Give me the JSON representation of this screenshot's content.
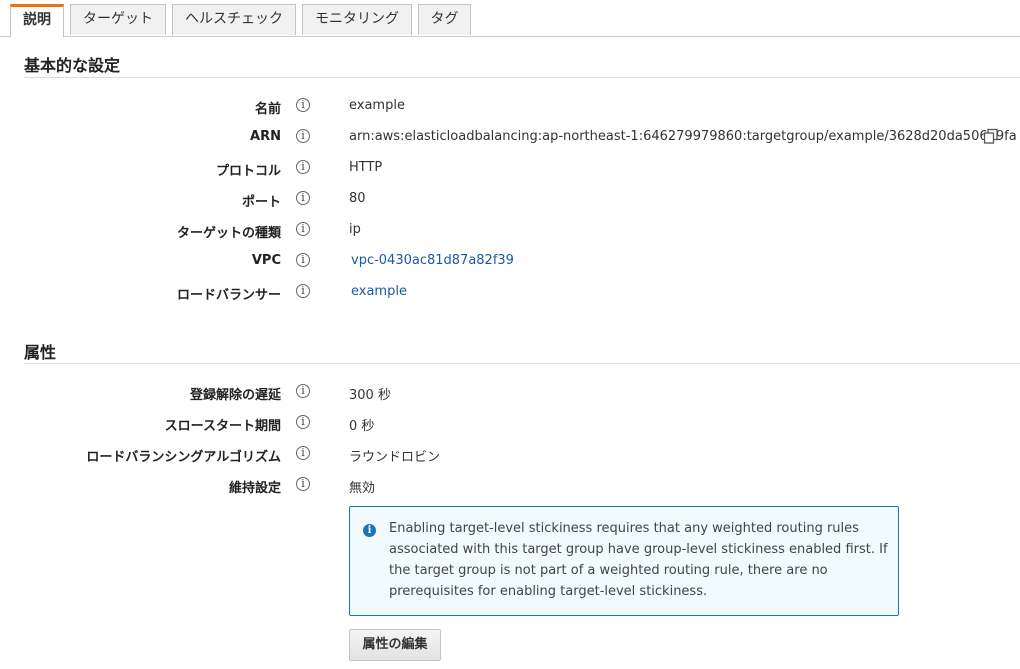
{
  "tabs": [
    {
      "label": "説明",
      "active": true
    },
    {
      "label": "ターゲット",
      "active": false
    },
    {
      "label": "ヘルスチェック",
      "active": false
    },
    {
      "label": "モニタリング",
      "active": false
    },
    {
      "label": "タグ",
      "active": false
    }
  ],
  "basic": {
    "title": "基本的な設定",
    "rows": [
      {
        "label": "名前",
        "value": "example"
      },
      {
        "label": "ARN",
        "value": "arn:aws:elasticloadbalancing:ap-northeast-1:646279979860:targetgroup/example/3628d20da50689fa"
      },
      {
        "label": "プロトコル",
        "value": "HTTP"
      },
      {
        "label": "ポート",
        "value": "80"
      },
      {
        "label": "ターゲットの種類",
        "value": "ip"
      },
      {
        "label": "VPC",
        "value": "vpc-0430ac81d87a82f39"
      },
      {
        "label": "ロードバランサー",
        "value": "example"
      }
    ]
  },
  "attributes": {
    "title": "属性",
    "rows": [
      {
        "label": "登録解除の遅延",
        "value": "300 秒"
      },
      {
        "label": "スロースタート期間",
        "value": "0 秒"
      },
      {
        "label": "ロードバランシングアルゴリズム",
        "value": "ラウンドロビン"
      },
      {
        "label": "維持設定",
        "value": "無効"
      }
    ]
  },
  "alert": {
    "text": "Enabling target-level stickiness requires that any weighted routing rules associated with this target group have group-level stickiness enabled first. If the target group is not part of a weighted routing rule, there are no prerequisites for enabling target-level stickiness."
  },
  "edit_button_label": "属性の編集",
  "icons": {
    "info": "info-icon",
    "copy": "copy-icon",
    "alert": "info-filled-icon"
  },
  "colors": {
    "active_tab_accent": "#ec7211",
    "link": "#1a5aa0",
    "alert_border": "#1a74b8",
    "alert_background": "#f1faff"
  }
}
